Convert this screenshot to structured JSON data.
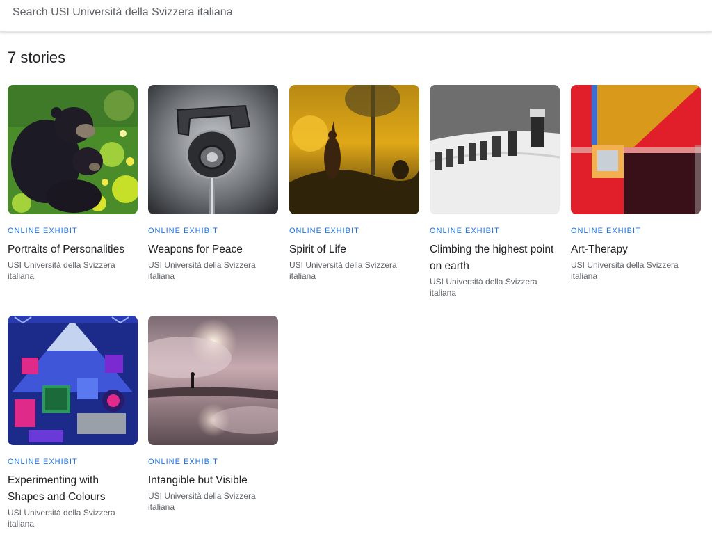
{
  "search": {
    "placeholder": "Search USI Università della Svizzera italiana",
    "value": ""
  },
  "section": {
    "title": "7 stories"
  },
  "stories": [
    {
      "kicker": "ONLINE EXHIBIT",
      "title": "Portraits of Personalities",
      "owner": "USI Università della Svizzera italiana"
    },
    {
      "kicker": "ONLINE EXHIBIT",
      "title": "Weapons for Peace",
      "owner": "USI Università della Svizzera italiana"
    },
    {
      "kicker": "ONLINE EXHIBIT",
      "title": "Spirit of Life",
      "owner": "USI Università della Svizzera italiana"
    },
    {
      "kicker": "ONLINE EXHIBIT",
      "title": "Climbing the highest point on earth",
      "owner": "USI Università della Svizzera italiana"
    },
    {
      "kicker": "ONLINE EXHIBIT",
      "title": "Art-Therapy",
      "owner": "USI Università della Svizzera italiana"
    },
    {
      "kicker": "ONLINE EXHIBIT",
      "title": "Experimenting with Shapes and Colours",
      "owner": "USI Università della Svizzera italiana"
    },
    {
      "kicker": "ONLINE EXHIBIT",
      "title": "Intangible but Visible",
      "owner": "USI Università della Svizzera italiana"
    }
  ],
  "colors": {
    "kicker": "#1a73e8",
    "title": "#202124",
    "owner": "#5f6368"
  }
}
